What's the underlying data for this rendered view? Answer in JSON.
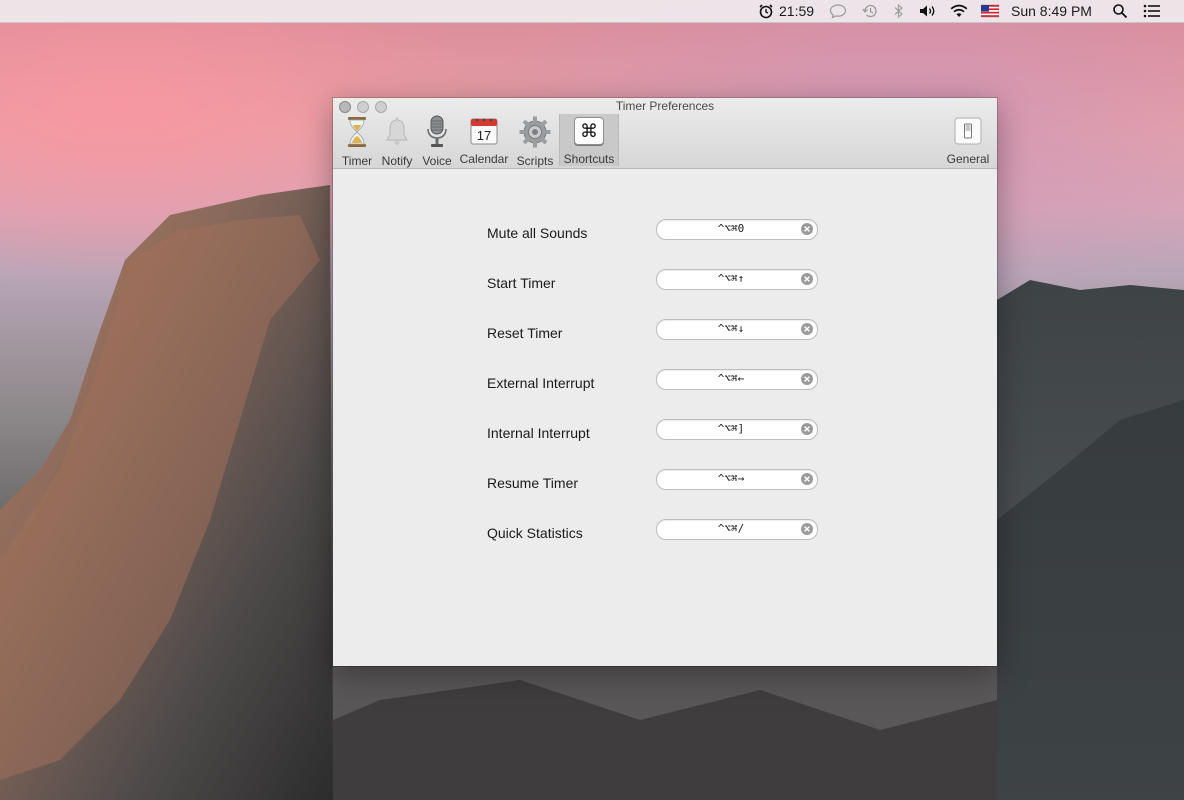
{
  "menubar": {
    "timer_readout": "21:59",
    "clock": "Sun 8:49 PM"
  },
  "window": {
    "title": "Timer Preferences",
    "toolbar": [
      {
        "label": "Timer",
        "icon": "hourglass-icon"
      },
      {
        "label": "Notify",
        "icon": "bell-icon"
      },
      {
        "label": "Voice",
        "icon": "microphone-icon"
      },
      {
        "label": "Calendar",
        "icon": "calendar-icon",
        "badge": "17"
      },
      {
        "label": "Scripts",
        "icon": "gear-icon"
      },
      {
        "label": "Shortcuts",
        "icon": "command-key-icon",
        "glyph": "⌘",
        "selected": true
      },
      {
        "label": "General",
        "icon": "switch-icon"
      }
    ]
  },
  "shortcuts": [
    {
      "label": "Mute all Sounds",
      "keys": "^⌥⌘0"
    },
    {
      "label": "Start Timer",
      "keys": "^⌥⌘↑"
    },
    {
      "label": "Reset Timer",
      "keys": "^⌥⌘↓"
    },
    {
      "label": "External Interrupt",
      "keys": "^⌥⌘←"
    },
    {
      "label": "Internal Interrupt",
      "keys": "^⌥⌘]"
    },
    {
      "label": "Resume Timer",
      "keys": "^⌥⌘→"
    },
    {
      "label": "Quick Statistics",
      "keys": "^⌥⌘/"
    }
  ],
  "colors": {
    "window_bg": "#ececec",
    "toolbar_selected": "#c9c9c9",
    "clear_button": "#9a9a9a"
  }
}
